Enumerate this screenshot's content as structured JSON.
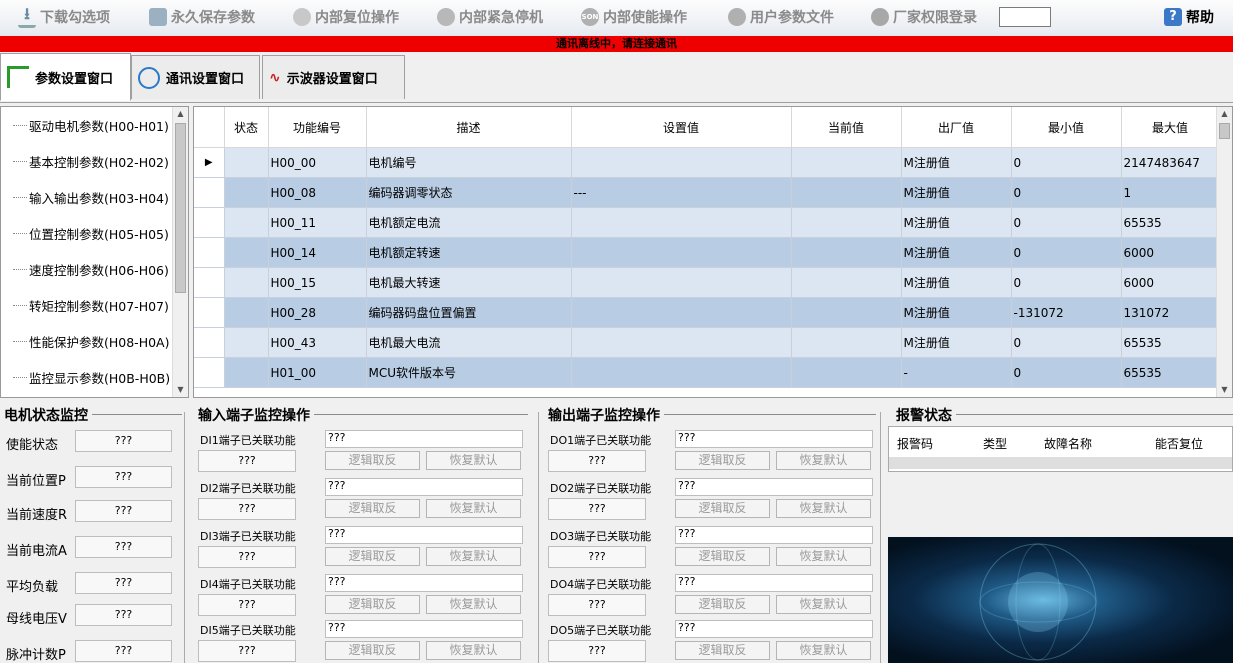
{
  "toolbar": {
    "download": "下载勾选项",
    "save": "永久保存参数",
    "reset": "内部复位操作",
    "estop": "内部紧急停机",
    "enable": "内部使能操作",
    "userfile": "用户参数文件",
    "vendor": "厂家权限登录",
    "help": "帮助"
  },
  "status_banner": "通讯离线中，请连接通讯",
  "tabs": [
    "参数设置窗口",
    "通讯设置窗口",
    "示波器设置窗口"
  ],
  "tree_items": [
    "驱动电机参数(H00-H01)",
    "基本控制参数(H02-H02)",
    "输入输出参数(H03-H04)",
    "位置控制参数(H05-H05)",
    "速度控制参数(H06-H06)",
    "转矩控制参数(H07-H07)",
    "性能保护参数(H08-H0A)",
    "监控显示参数(H0B-H0B)"
  ],
  "grid": {
    "columns": [
      "状态",
      "功能编号",
      "描述",
      "设置值",
      "当前值",
      "出厂值",
      "最小值",
      "最大值"
    ],
    "rows": [
      [
        "",
        "H00_00",
        "电机编号",
        "",
        "",
        "M注册值",
        "0",
        "2147483647"
      ],
      [
        "",
        "H00_08",
        "编码器调零状态",
        "---",
        "",
        "M注册值",
        "0",
        "1"
      ],
      [
        "",
        "H00_11",
        "电机额定电流",
        "",
        "",
        "M注册值",
        "0",
        "65535"
      ],
      [
        "",
        "H00_14",
        "电机额定转速",
        "",
        "",
        "M注册值",
        "0",
        "6000"
      ],
      [
        "",
        "H00_15",
        "电机最大转速",
        "",
        "",
        "M注册值",
        "0",
        "6000"
      ],
      [
        "",
        "H00_28",
        "编码器码盘位置偏置",
        "",
        "",
        "M注册值",
        "-131072",
        "131072"
      ],
      [
        "",
        "H00_43",
        "电机最大电流",
        "",
        "",
        "M注册值",
        "0",
        "65535"
      ],
      [
        "",
        "H01_00",
        "MCU软件版本号",
        "",
        "",
        "-",
        "0",
        "65535"
      ]
    ]
  },
  "motor_status": {
    "title": "电机状态监控",
    "items": [
      {
        "label": "使能状态",
        "value": "???"
      },
      {
        "label": "当前位置P",
        "value": "???"
      },
      {
        "label": "当前速度R",
        "value": "???"
      },
      {
        "label": "当前电流A",
        "value": "???"
      },
      {
        "label": "平均负载",
        "value": "???"
      },
      {
        "label": "母线电压V",
        "value": "???"
      },
      {
        "label": "脉冲计数P",
        "value": "???"
      }
    ]
  },
  "input_monitor": {
    "title": "输入端子监控操作",
    "items": [
      {
        "label": "DI1端子已关联功能",
        "value": "???",
        "func": "???"
      },
      {
        "label": "DI2端子已关联功能",
        "value": "???",
        "func": "???"
      },
      {
        "label": "DI3端子已关联功能",
        "value": "???",
        "func": "???"
      },
      {
        "label": "DI4端子已关联功能",
        "value": "???",
        "func": "???"
      },
      {
        "label": "DI5端子已关联功能",
        "value": "???",
        "func": "???"
      }
    ],
    "btn_invert": "逻辑取反",
    "btn_default": "恢复默认"
  },
  "output_monitor": {
    "title": "输出端子监控操作",
    "items": [
      {
        "label": "DO1端子已关联功能",
        "value": "???",
        "func": "???"
      },
      {
        "label": "DO2端子已关联功能",
        "value": "???",
        "func": "???"
      },
      {
        "label": "DO3端子已关联功能",
        "value": "???",
        "func": "???"
      },
      {
        "label": "DO4端子已关联功能",
        "value": "???",
        "func": "???"
      },
      {
        "label": "DO5端子已关联功能",
        "value": "???",
        "func": "???"
      }
    ],
    "btn_invert": "逻辑取反",
    "btn_default": "恢复默认"
  },
  "alarm": {
    "title": "报警状态",
    "columns": [
      "报警码",
      "类型",
      "故障名称",
      "能否复位"
    ]
  }
}
